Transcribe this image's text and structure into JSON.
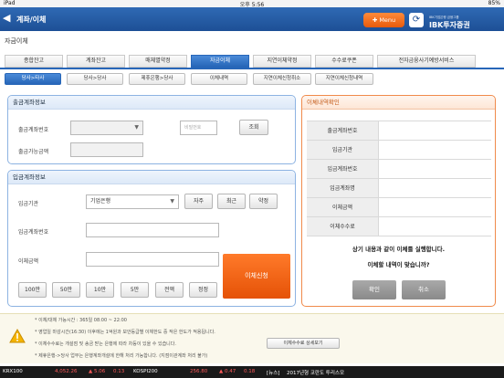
{
  "status": {
    "device": "iPad",
    "time": "오후 5:56",
    "battery": "85%"
  },
  "header": {
    "back_icon": "back-arrow-icon",
    "title": "계좌/이체",
    "menu_label": "Menu",
    "refresh_icon": "refresh-icon",
    "logo_small": "IBK기업은행 금융그룹",
    "logo_big": "IBK투자증권"
  },
  "section_title": "자금이체",
  "main_tabs": [
    "종합잔고",
    "계좌잔고",
    "매체별약정",
    "자금이체",
    "지연이체약정",
    "수수료쿠폰",
    "전자금융사기예방서비스"
  ],
  "sub_tabs": [
    "당사>타사",
    "당사>당사",
    "제휴은행>당사",
    "이체내역",
    "지연이체신청취소",
    "지연이체신청내역"
  ],
  "withdraw": {
    "title": "출금계좌정보",
    "account_label": "출금계좌번호",
    "password_placeholder": "비밀번호",
    "lookup_label": "조회",
    "available_label": "출금가능금액"
  },
  "deposit": {
    "title": "입금계좌정보",
    "bank_label": "입금기관",
    "bank_value": "기업은행",
    "btn_frequent": "자주",
    "btn_recent": "최근",
    "btn_promise": "약정",
    "account_label": "입금계좌번호",
    "amount_label": "이체금액",
    "transfer_label": "이체신청",
    "amount_buttons": [
      "100만",
      "50만",
      "10만",
      "5만",
      "전액",
      "정정"
    ]
  },
  "confirm": {
    "title": "이체내역확인",
    "rows": [
      "출금계좌번호",
      "입금기관",
      "입금계좌번호",
      "입금계좌명",
      "이체금액",
      "이체수수료"
    ],
    "msg1": "상기 내용과 같이 이체를 실행합니다.",
    "msg2": "이체할 내역이 맞습니까?",
    "ok_label": "확인",
    "cancel_label": "취소"
  },
  "notes": [
    "* 이체/대체 가능시간 : 365일 08:00 ~ 22:00",
    "* 영업일 마감시간(16:30) 이후에는 1억원과 보안등급별 이체한도 중 작은 한도가 적용됩니다.",
    "* 이체수수료는 개설점 및 송금 받는 은행에 따라 차등이 있을 수 있습니다.",
    "* 제휴은행->당사 업무는 은행계좌개설에 한해 처리 가능합니다. (지점이관계좌 처리 불가)"
  ],
  "fee_button": "이체수수료 상세보기",
  "ticker": {
    "krx_label": "KRX100",
    "krx_value": "4,052.26",
    "krx_change": "▲ 5.06",
    "krx_pct": "0.13",
    "kospi_label": "KOSPI200",
    "kospi_value": "256.80",
    "kospi_change": "▲ 0.47",
    "kospi_pct": "0.18",
    "news_label": "[뉴스]",
    "news_text": "2017년형 코란도 투리스모"
  },
  "colors": {
    "accent_blue": "#2766b8",
    "orange": "#e85a0c",
    "up_red": "#ff5a5a"
  }
}
